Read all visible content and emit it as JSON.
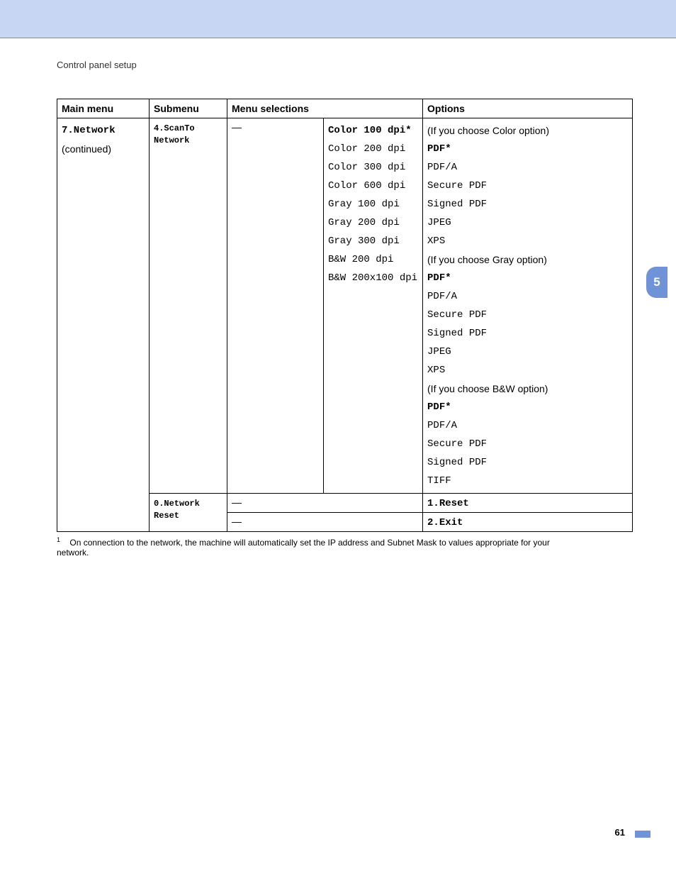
{
  "section_title": "Control panel setup",
  "side_tab": "5",
  "page_number": "61",
  "headers": {
    "main_menu": "Main menu",
    "submenu": "Submenu",
    "menu_selections": "Menu selections",
    "options": "Options"
  },
  "main_menu": {
    "line1": "7.Network",
    "line2": "(continued)"
  },
  "submenu1": "4.ScanTo Network",
  "submenu2": "0.Network Reset",
  "dash": "—",
  "selections_col4": [
    "Color 100 dpi*",
    "Color 200 dpi",
    "Color 300 dpi",
    "Color 600 dpi",
    "Gray 100 dpi",
    "Gray 200 dpi",
    "Gray 300 dpi",
    "B&W 200 dpi",
    "B&W 200x100 dpi"
  ],
  "options_col5": {
    "color_header": "(If you choose Color option)",
    "color": [
      "PDF*",
      "PDF/A",
      "Secure PDF",
      "Signed PDF",
      "JPEG",
      "XPS"
    ],
    "gray_header": "(If you choose Gray option)",
    "gray": [
      "PDF*",
      "PDF/A",
      "Secure PDF",
      "Signed PDF",
      "JPEG",
      "XPS"
    ],
    "bw_header": "(If you choose B&W option)",
    "bw": [
      "PDF*",
      "PDF/A",
      "Secure PDF",
      "Signed PDF",
      "TIFF"
    ]
  },
  "reset_option": "1.Reset",
  "exit_option": "2.Exit",
  "footnote": {
    "marker": "1",
    "text": "On connection to the network, the machine will automatically set the IP address and Subnet Mask to values appropriate for your network."
  }
}
